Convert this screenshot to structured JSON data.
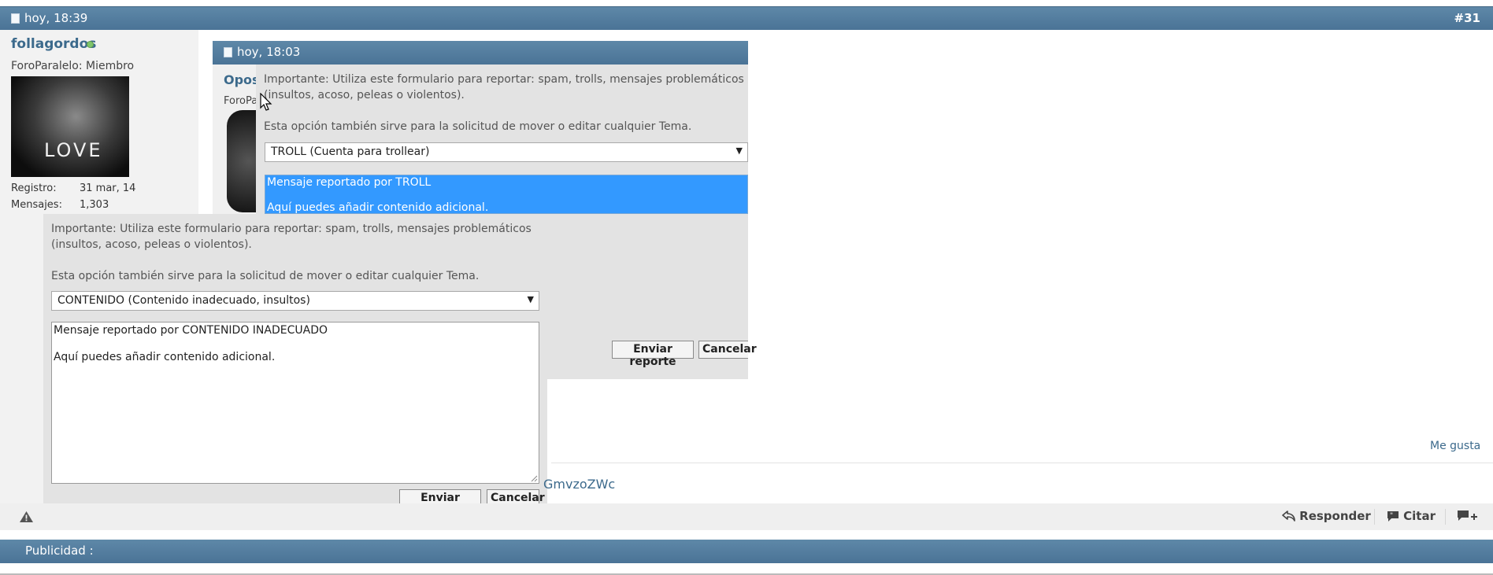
{
  "post": {
    "date": "hoy, 18:39",
    "number": "#31",
    "username": "follagordos",
    "user_title": "ForoParalelo: Miembro",
    "avatar_text": "LOVE",
    "registro_label": "Registro:",
    "registro_value": "31 mar, 14",
    "mensajes_label": "Mensajes:",
    "mensajes_value": "1,303"
  },
  "quote": {
    "date": "hoy, 18:03",
    "name_partial": "Opos",
    "sub_partial": "ForoPa"
  },
  "report_dialog_bg": {
    "notice": "Importante: Utiliza este formulario para reportar: spam, trolls, mensajes problemáticos (insultos, acoso, peleas o violentos).",
    "hint": "Esta opción también sirve para la solicitud de mover o editar cualquier Tema.",
    "selected_option": "TROLL (Cuenta para trollear)",
    "text_line1": "Mensaje reportado por TROLL",
    "text_line2": "Aquí puedes añadir contenido adicional.",
    "submit_label": "Enviar reporte",
    "cancel_label": "Cancelar"
  },
  "report_dialog_fg": {
    "notice": "Importante: Utiliza este formulario para reportar: spam, trolls, mensajes problemáticos (insultos, acoso, peleas o violentos).",
    "hint": "Esta opción también sirve para la solicitud de mover o editar cualquier Tema.",
    "selected_option": "CONTENIDO (Contenido inadecuado, insultos)",
    "text_line1": "Mensaje reportado por CONTENIDO INADECUADO",
    "text_line2": "Aquí puedes añadir contenido adicional.",
    "submit_label": "Enviar reporte",
    "cancel_label": "Cancelar"
  },
  "link_partial": "GmvzoZWc",
  "me_gusta": "Me gusta",
  "actions": {
    "responder": "Responder",
    "citar": "Citar"
  },
  "ad_label": "Publicidad :",
  "icons": {
    "report": "warning-triangle-icon",
    "reply": "reply-arrow-icon",
    "quote": "quote-bubble-icon",
    "multiquote": "multiquote-plus-icon"
  }
}
